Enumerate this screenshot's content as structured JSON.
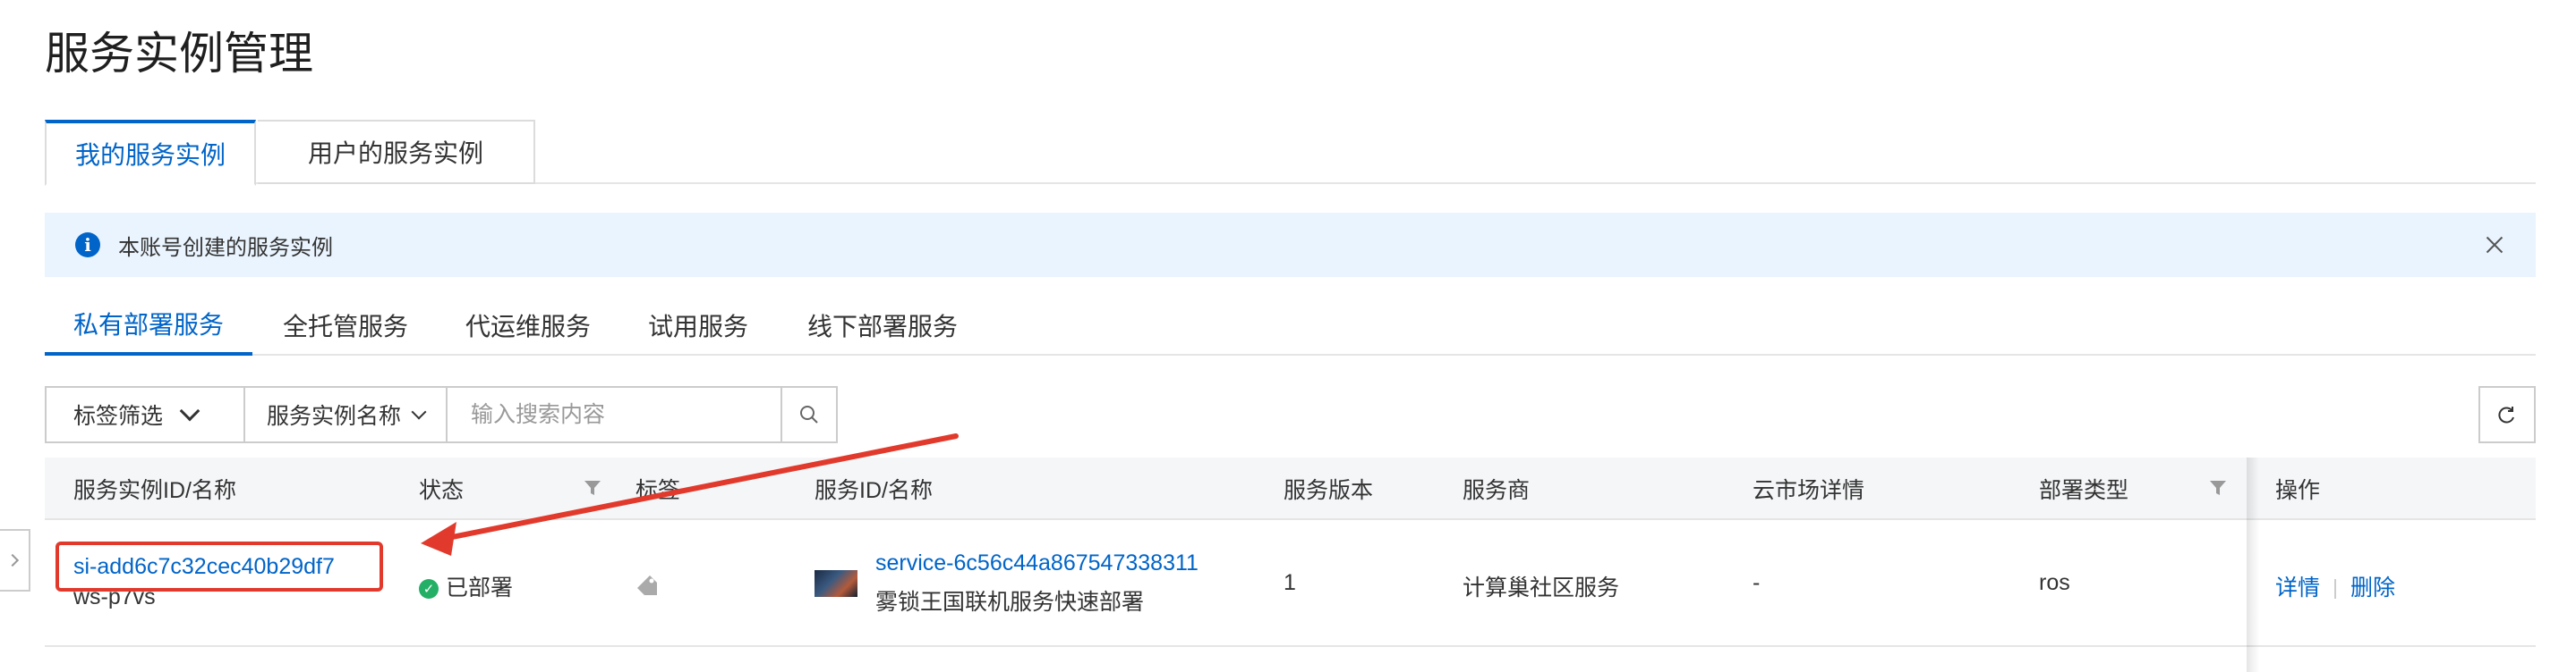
{
  "page": {
    "title": "服务实例管理"
  },
  "top_tabs": [
    {
      "label": "我的服务实例",
      "active": true
    },
    {
      "label": "用户的服务实例",
      "active": false
    }
  ],
  "banner": {
    "text": "本账号创建的服务实例",
    "icon": "info-icon"
  },
  "sub_tabs": [
    {
      "label": "私有部署服务",
      "active": true
    },
    {
      "label": "全托管服务"
    },
    {
      "label": "代运维服务"
    },
    {
      "label": "试用服务"
    },
    {
      "label": "线下部署服务"
    }
  ],
  "toolbar": {
    "tag_filter_label": "标签筛选",
    "search_field_label": "服务实例名称",
    "search_placeholder": "输入搜索内容"
  },
  "table": {
    "columns": [
      "服务实例ID/名称",
      "状态",
      "标签",
      "服务ID/名称",
      "服务版本",
      "服务商",
      "云市场详情",
      "部署类型",
      "操作"
    ],
    "rows": [
      {
        "instance_id": "si-add6c7c32cec40b29df7",
        "instance_name": "ws-p7vs",
        "status": "已部署",
        "service_id": "service-6c56c44a867547338311",
        "service_name": "雾锁王国联机服务快速部署",
        "version": "1",
        "provider": "计算巢社区服务",
        "market_detail": "-",
        "deploy_type": "ros",
        "actions": {
          "detail": "详情",
          "delete": "删除"
        }
      }
    ]
  },
  "colors": {
    "accent": "#0064c8",
    "banner_bg": "#eaf4fe",
    "status_green": "#23b066",
    "annotation_red": "#e13a2c"
  }
}
